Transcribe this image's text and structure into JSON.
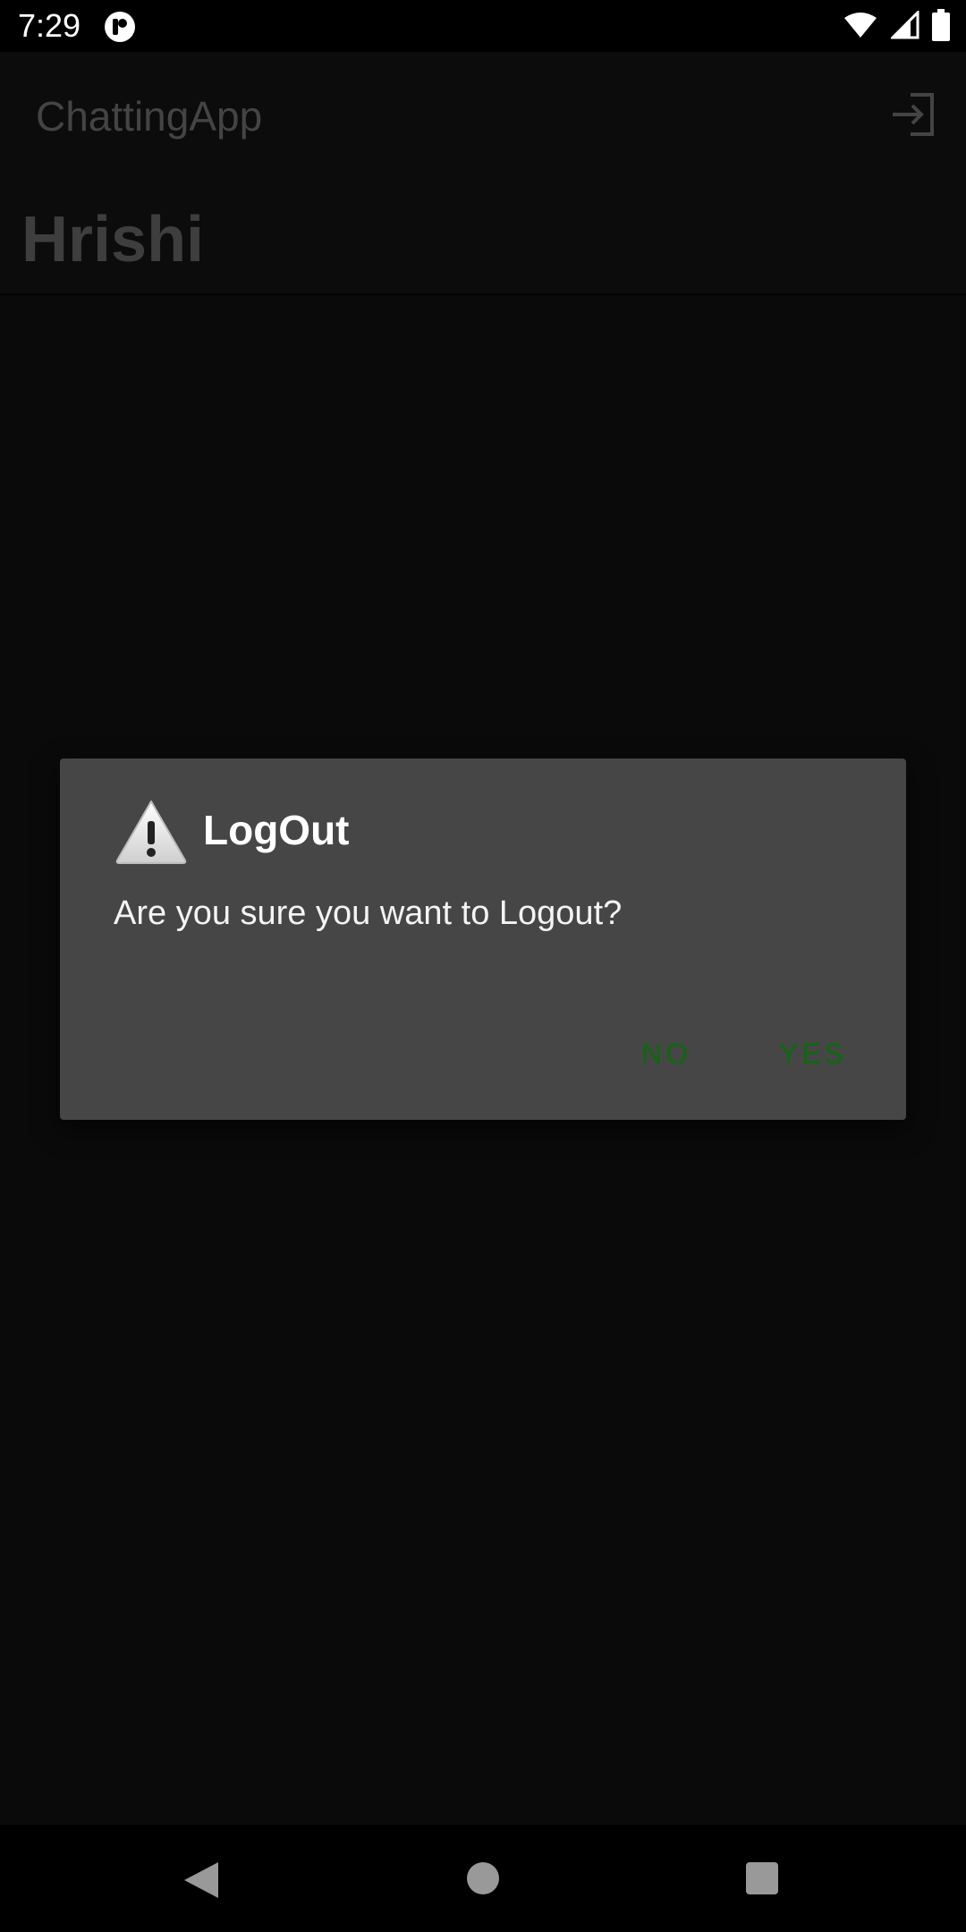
{
  "status_bar": {
    "time": "7:29",
    "icons": [
      "app-notification-icon",
      "wifi-icon",
      "signal-icon",
      "battery-icon"
    ]
  },
  "app_bar": {
    "title": "ChattingApp",
    "logout_icon": "logout-icon"
  },
  "user": {
    "name": "Hrishi"
  },
  "dialog": {
    "icon": "warning-icon",
    "title": "LogOut",
    "message": "Are you sure you want to Logout?",
    "negative_label": "NO",
    "positive_label": "YES",
    "button_color": "#0c6a0c"
  },
  "nav_bar": {
    "icons": [
      "back-icon",
      "home-icon",
      "recents-icon"
    ]
  }
}
